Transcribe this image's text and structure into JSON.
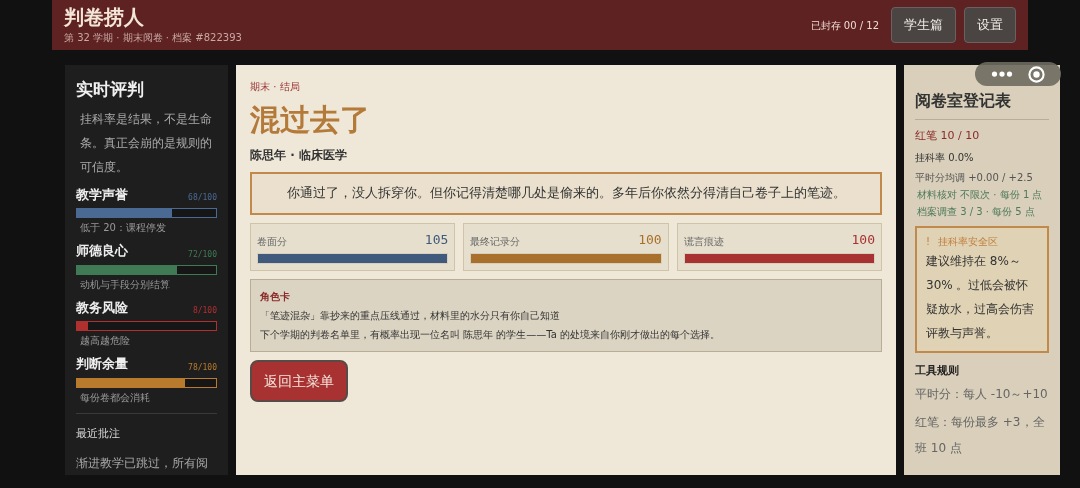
{
  "header": {
    "title": "判卷捞人",
    "subtitle": "第 32 学期 · 期末阅卷 · 档案 #822393",
    "sealed": "已封存 00 / 12",
    "buttons": [
      "学生篇",
      "设置"
    ]
  },
  "sidebar": {
    "title": "实时评判",
    "intro": "挂科率是结果，不是生命条。真正会崩的是规则的可信度。",
    "meters": [
      {
        "name": "教学声誉",
        "reading": "68/100",
        "level": 0.68,
        "note": "低于 20：课程停发",
        "color": "#4a6a94"
      },
      {
        "name": "师德良心",
        "reading": "72/100",
        "level": 0.72,
        "note": "动机与手段分别结算",
        "color": "#3f7a55"
      },
      {
        "name": "教务风险",
        "reading": "8/100",
        "level": 0.08,
        "note": "越高越危险",
        "color": "#b03030"
      },
      {
        "name": "判断余量",
        "reading": "78/100",
        "level": 0.78,
        "note": "每份卷都会消耗",
        "color": "#b87a2c"
      }
    ],
    "recent_title": "最近批注",
    "recent_text": "渐进教学已跳过，所有阅"
  },
  "main": {
    "breadcrumb": "期末 · 结局",
    "title": "混过去了",
    "student": "陈思年 · 临床医学",
    "verdict": "你通过了，没人拆穿你。但你记得清楚哪几处是偷来的。多年后你依然分得清自己卷子上的笔迹。",
    "scores": [
      {
        "label": "卷面分",
        "value": "105",
        "level": 1,
        "color": "#3f5a7c"
      },
      {
        "label": "最终记录分",
        "value": "100",
        "level": 1,
        "color": "#a8702a"
      },
      {
        "label": "谎言痕迹",
        "value": "100",
        "level": 1,
        "color": "#a83232"
      }
    ],
    "card": {
      "title": "角色卡",
      "lines": [
        "「笔迹混杂」靠抄来的重点压线通过，材料里的水分只有你自己知道",
        "下个学期的判卷名单里，有概率出现一位名叫 陈思年 的学生——Ta 的处境来自你刚才做出的每个选择。"
      ]
    },
    "button": "返回主菜单"
  },
  "register": {
    "title": "阅卷室登记表",
    "red_pen": "红笔 10 / 10",
    "fail_rate": "挂科率 0.0%",
    "usual": "平时分均调 +0.00 / +2.5",
    "checks": [
      "材料核对 不限次 · 每份 1 点",
      "档案调查 3 / 3 · 每份 5 点"
    ],
    "alert": {
      "icon": "!",
      "title": "挂科率安全区",
      "text": "建议维持在 8%～30% 。过低会被怀疑放水，过高会伤害评教与声誉。"
    },
    "rules_title": "工具规则",
    "rules": [
      "平时分：每人 -10～+10",
      "红笔：每份最多 +3，全班 10 点"
    ]
  }
}
